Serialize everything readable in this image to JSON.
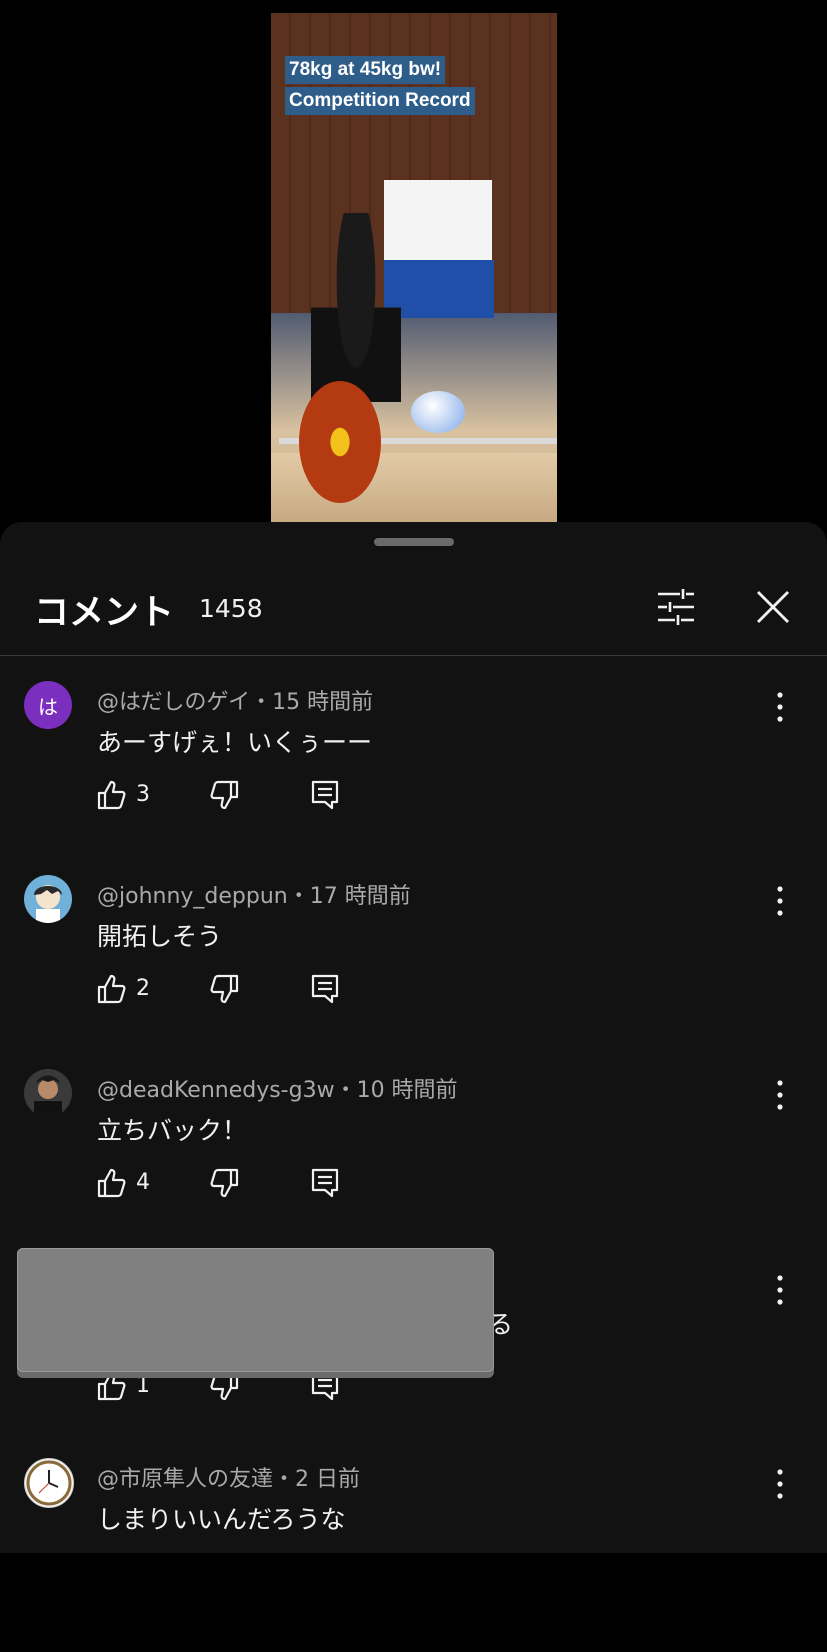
{
  "video": {
    "caption_line1": "78kg at 45kg bw!",
    "caption_line2": "Competition Record"
  },
  "sheet": {
    "title": "コメント",
    "count": "1458"
  },
  "comments": [
    {
      "meta": "@はだしのゲイ・15 時間前",
      "text": "あーすげぇ！いくぅーー",
      "likes": "3",
      "avatar_letter": "は",
      "avatar_color": "#7b2fbe"
    },
    {
      "meta": "@johnny_deppun・17 時間前",
      "text": "開拓しそう",
      "likes": "2"
    },
    {
      "meta": "@deadKennedys-g3w・10 時間前",
      "text": "立ちバック！",
      "likes": "4"
    },
    {
      "meta": "",
      "text": "る",
      "likes": "1"
    },
    {
      "meta": "@市原隼人の友達・2 日前",
      "text": "しまりいいんだろうな",
      "likes": ""
    }
  ],
  "colors": {
    "background": "#000000",
    "sheet": "#121212",
    "meta_text": "#aaaaaa",
    "primary_text": "#f1f1f1",
    "redaction": "#808080"
  },
  "icons": [
    "sliders-icon",
    "close-icon",
    "more-vert-icon",
    "thumb-up-icon",
    "thumb-down-icon",
    "reply-icon"
  ]
}
